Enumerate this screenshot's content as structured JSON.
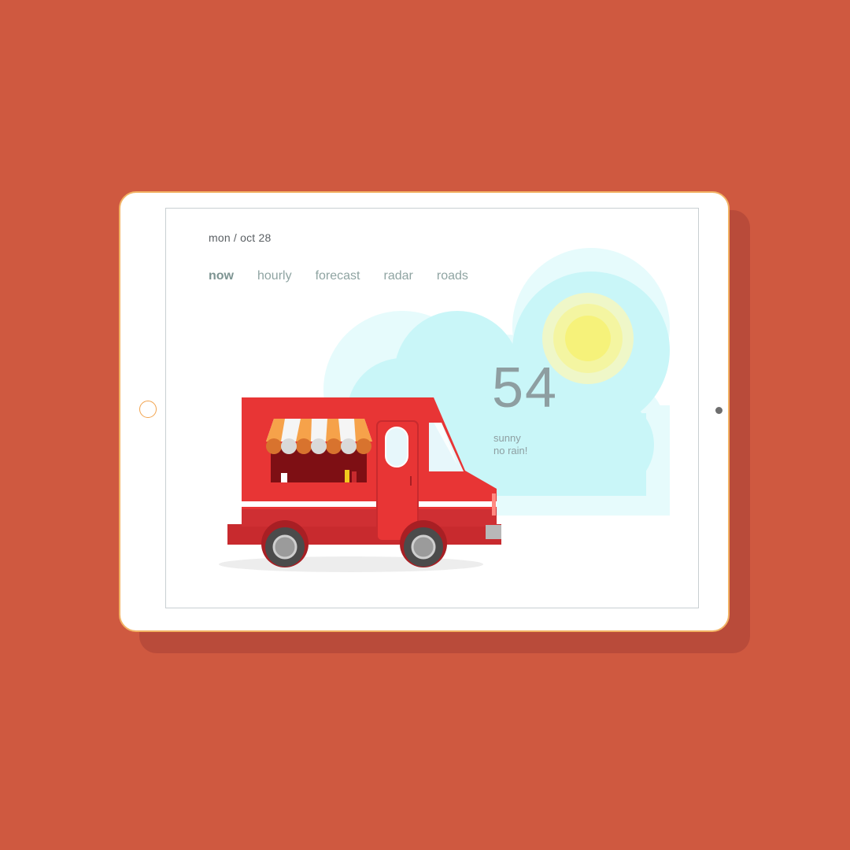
{
  "colors": {
    "background": "#cf5940",
    "device_frame": "#ffffff",
    "device_border": "#f2b264",
    "cloud": "#c9f6f8",
    "sun": "#f6f27a",
    "truck_red": "#e83535"
  },
  "header": {
    "date": "mon / oct 28"
  },
  "nav": {
    "tabs": [
      {
        "label": "now",
        "active": true
      },
      {
        "label": "hourly",
        "active": false
      },
      {
        "label": "forecast",
        "active": false
      },
      {
        "label": "radar",
        "active": false
      },
      {
        "label": "roads",
        "active": false
      }
    ]
  },
  "weather": {
    "temperature": "54",
    "condition": "sunny",
    "precipitation": "no rain!"
  },
  "icons": {
    "sun": "sun-icon",
    "cloud": "cloud-icon",
    "vehicle": "food-truck-illustration"
  }
}
